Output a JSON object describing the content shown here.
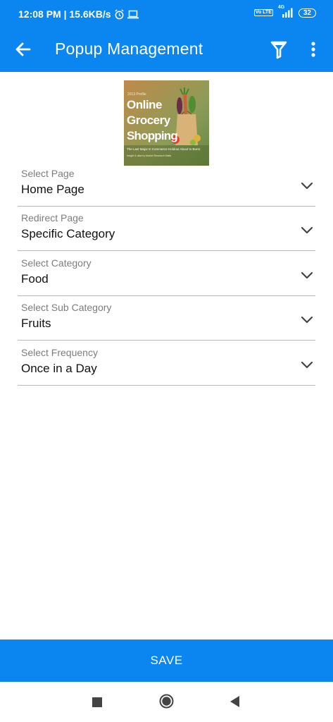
{
  "status_bar": {
    "time_network": "12:08 PM | 15.6KB/s",
    "volte": "Vo LTE",
    "network_type": "4G",
    "battery": "32"
  },
  "app_bar": {
    "title": "Popup Management",
    "icons": [
      "arrow-left-icon",
      "filter-icon",
      "more-vertical-icon"
    ]
  },
  "banner": {
    "kicker": "2013 Profile",
    "line1": "Online",
    "line2": "Grocery",
    "line3": "Shopping",
    "tagline": "The Last Major E-Commerce Holdout About to Burst",
    "byline": "Insight & data by Market Research Mafia"
  },
  "form": {
    "fields": [
      {
        "label": "Select Page",
        "value": "Home Page"
      },
      {
        "label": "Redirect Page",
        "value": "Specific Category"
      },
      {
        "label": "Select Category",
        "value": "Food"
      },
      {
        "label": "Select Sub Category",
        "value": "Fruits"
      },
      {
        "label": "Select Frequency",
        "value": "Once in a Day"
      }
    ]
  },
  "save_button": {
    "label": "SAVE"
  },
  "colors": {
    "primary": "#0b86f0",
    "divider": "#b8b8b8",
    "label": "#7d7d7d"
  }
}
